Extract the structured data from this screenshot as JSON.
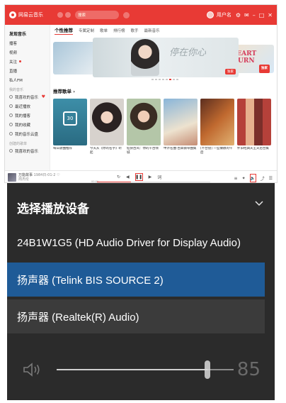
{
  "app": {
    "title": "网易云音乐",
    "search_placeholder": "搜索",
    "username": "用户名"
  },
  "sidebar": {
    "items": [
      {
        "label": "发现音乐",
        "active": true
      },
      {
        "label": "播客"
      },
      {
        "label": "视频"
      },
      {
        "label": "关注"
      },
      {
        "label": "直播"
      },
      {
        "label": "私人FM"
      }
    ],
    "section_my": "我的音乐",
    "my_items": [
      {
        "label": "我喜欢的音乐"
      },
      {
        "label": "最近播放"
      },
      {
        "label": "我的播客"
      },
      {
        "label": "我的收藏"
      },
      {
        "label": "我的音乐云盘"
      }
    ],
    "section_created": "创建的歌单",
    "created_items": [
      {
        "label": "我喜欢的音乐"
      }
    ]
  },
  "main": {
    "tabs": [
      "个性推荐",
      "专属定制",
      "歌单",
      "排行榜",
      "歌手",
      "最新音乐"
    ],
    "banner": {
      "calligraphy": "停在你心",
      "exclusive": "独家",
      "heart_line1": "HEART",
      "heart_line2": "BURN",
      "heart_badge": "独家"
    },
    "section_title": "推荐歌单",
    "playlists": [
      {
        "title": "每日歌曲推荐",
        "calendar_day": "30"
      },
      {
        "title": "今天从《你的名字》听起",
        "plays": ""
      },
      {
        "title": "仙侠古风：你的千古倾城",
        "plays": ""
      },
      {
        "title": "中外名曲·古典钢琴曲集",
        "plays": ""
      },
      {
        "title": "[不合盘] 一些懒散的午后",
        "plays": ""
      },
      {
        "title": "怀旧经典天王天后合集",
        "plays": ""
      }
    ]
  },
  "playbar": {
    "song": "万能故事",
    "duration": "1984日-01-2",
    "artist": "周杰伦",
    "time": "00:00"
  },
  "flyout": {
    "header": "选择播放设备",
    "devices": [
      {
        "label": "24B1W1G5 (HD Audio Driver for Display Audio)",
        "selected": false
      },
      {
        "label": "扬声器 (Telink BIS SOURCE 2)",
        "selected": true
      },
      {
        "label": "扬声器 (Realtek(R) Audio)",
        "selected": false
      }
    ],
    "volume": 85,
    "volume_label": "85"
  },
  "colors": {
    "brand": "#e83a35",
    "flyout_bg": "#2b2b2b",
    "selected": "#1f5b97"
  }
}
